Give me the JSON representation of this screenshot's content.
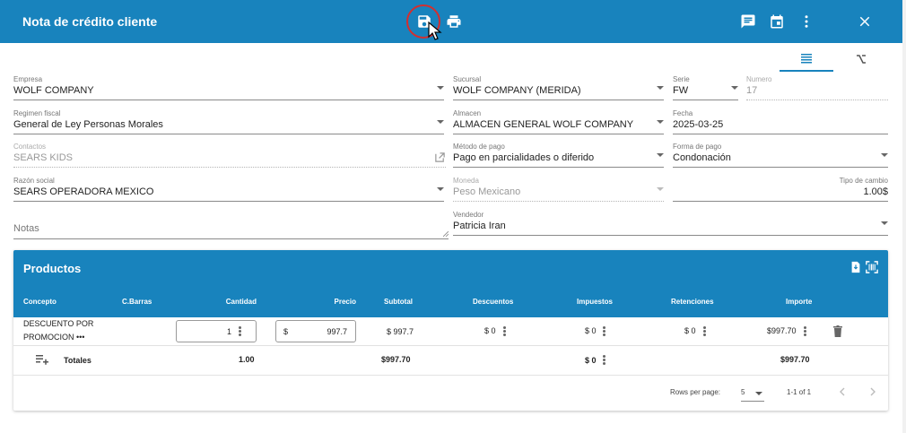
{
  "header": {
    "title": "Nota de crédito cliente",
    "icons": [
      "save-icon",
      "print-icon",
      "comment-icon",
      "calendar-icon",
      "more-vert-icon",
      "close-icon"
    ]
  },
  "view_tabs": [
    "list-icon",
    "formula-icon"
  ],
  "form": {
    "empresa": {
      "label": "Empresa",
      "value": "WOLF COMPANY"
    },
    "sucursal": {
      "label": "Sucursal",
      "value": "WOLF COMPANY (MERIDA)"
    },
    "serie": {
      "label": "Serie",
      "value": "FW"
    },
    "numero": {
      "label": "Numero",
      "value": "17"
    },
    "regimen": {
      "label": "Regimen fiscal",
      "value": "General de Ley Personas Morales"
    },
    "almacen": {
      "label": "Almacen",
      "value": "ALMACEN GENERAL WOLF COMPANY"
    },
    "fecha": {
      "label": "Fecha",
      "value": "2025-03-25"
    },
    "contactos": {
      "label": "Contactos",
      "value": "SEARS KIDS"
    },
    "metodo_pago": {
      "label": "Método de pago",
      "value": "Pago en parcialidades o diferido"
    },
    "forma_pago": {
      "label": "Forma de pago",
      "value": "Condonación"
    },
    "razon_social": {
      "label": "Razón social",
      "value": "SEARS OPERADORA MEXICO"
    },
    "moneda": {
      "label": "Moneda",
      "value": "Peso Mexicano"
    },
    "tipo_cambio": {
      "label": "Tipo de cambio",
      "value": "1.00$"
    },
    "notas": {
      "label": "Notas",
      "value": ""
    },
    "vendedor": {
      "label": "Vendedor",
      "value": "Patricia Iran"
    }
  },
  "productos": {
    "title": "Productos",
    "columns": [
      "Concepto",
      "C.Barras",
      "Cantidad",
      "Precio",
      "Subtotal",
      "Descuentos",
      "Impuestos",
      "Retenciones",
      "Importe"
    ],
    "rows": [
      {
        "concepto_line1": "DESCUENTO POR",
        "concepto_line2": "PROMOCION •••",
        "cantidad": "1",
        "precio_currency": "$",
        "precio": "997.7",
        "subtotal": "$ 997.7",
        "descuentos": "$ 0",
        "impuestos": "$ 0",
        "retenciones": "$ 0",
        "importe": "$997.70"
      }
    ],
    "totals": {
      "label": "Totales",
      "cantidad": "1.00",
      "subtotal": "$997.70",
      "impuestos": "$ 0",
      "importe": "$997.70"
    },
    "pagination": {
      "rows_per_page_label": "Rows per page:",
      "rows_per_page": "5",
      "range": "1-1 of 1"
    }
  }
}
